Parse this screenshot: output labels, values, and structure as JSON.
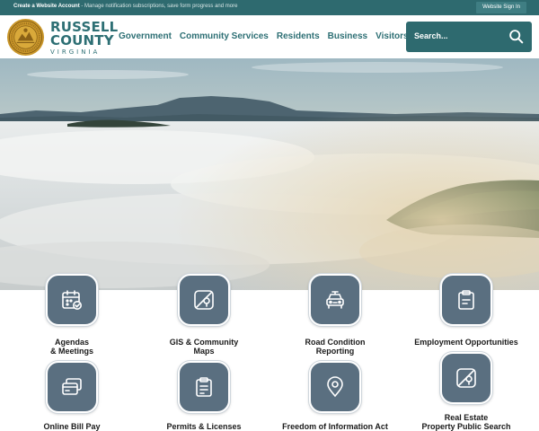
{
  "topbar": {
    "account_bold": "Create a Website Account",
    "account_rest": " - Manage notification subscriptions, save form progress and more",
    "signin_label": "Website Sign In"
  },
  "brand": {
    "line1": "RUSSELL",
    "line2": "COUNTY",
    "line3": "VIRGINIA"
  },
  "nav": {
    "items": [
      {
        "label": "Government"
      },
      {
        "label": "Community Services"
      },
      {
        "label": "Residents"
      },
      {
        "label": "Business"
      },
      {
        "label": "Visitors"
      }
    ]
  },
  "search": {
    "placeholder": "Search...",
    "icon": "search-icon"
  },
  "quicklinks": {
    "items": [
      {
        "line1": "Agendas",
        "line2": "& Meetings",
        "icon": "calendar-icon"
      },
      {
        "line1": "GIS & Community",
        "line2": "Maps",
        "icon": "map-icon"
      },
      {
        "line1": "Road Condition",
        "line2": "Reporting",
        "icon": "vehicle-icon"
      },
      {
        "line1": "Employment Opportunities",
        "line2": "",
        "icon": "clipboard-icon"
      },
      {
        "line1": "Online Bill Pay",
        "line2": "",
        "icon": "credit-card-icon"
      },
      {
        "line1": "Permits & Licenses",
        "line2": "",
        "icon": "clipboard-icon"
      },
      {
        "line1": "Freedom of Information Act",
        "line2": "",
        "icon": "location-pin-icon"
      },
      {
        "line1": "Real Estate",
        "line2": "Property Public Search",
        "icon": "map-icon"
      }
    ]
  },
  "colors": {
    "brand_teal": "#2d6f74",
    "topbar": "#2e6a6f",
    "tile": "#5a6f80"
  }
}
